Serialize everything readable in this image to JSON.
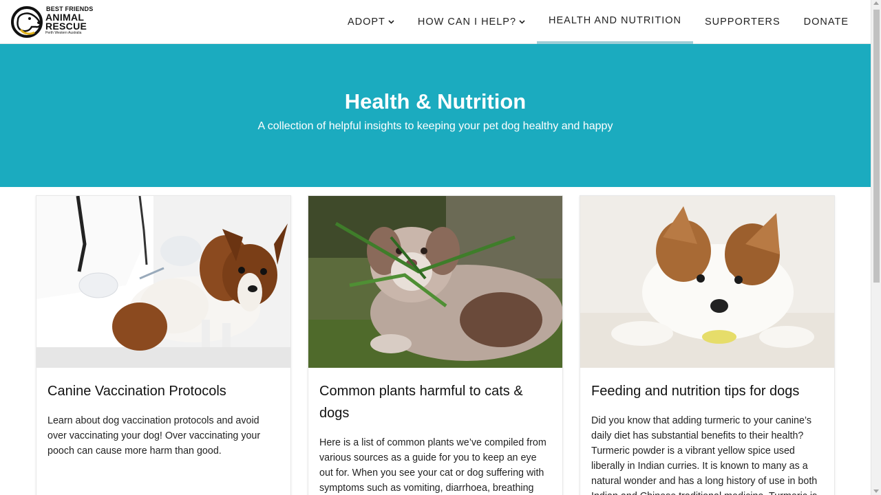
{
  "logo": {
    "line1": "BEST FRIENDS",
    "line2": "ANIMAL",
    "line3": "RESCUE",
    "line4": "Perth Western Australia"
  },
  "nav": {
    "items": [
      {
        "label": "ADOPT",
        "dropdown": true
      },
      {
        "label": "HOW CAN I HELP?",
        "dropdown": true
      },
      {
        "label": "HEALTH AND NUTRITION",
        "dropdown": false,
        "active": true
      },
      {
        "label": "SUPPORTERS",
        "dropdown": false
      },
      {
        "label": "DONATE",
        "dropdown": false
      }
    ]
  },
  "hero": {
    "title": "Health & Nutrition",
    "subtitle": "A collection of helpful insights to keeping your pet dog healthy and happy",
    "background": "#1babbf"
  },
  "cards": [
    {
      "image": "dog-vaccination-photo",
      "title": "Canine Vaccination Protocols",
      "text": "Learn about dog vaccination protocols and avoid over vaccinating your dog! Over vaccinating your pooch can cause more harm than good."
    },
    {
      "image": "puppy-chewing-plant-photo",
      "title": "Common plants harmful to cats & dogs",
      "text": "Here is a list of common plants we’ve compiled from various sources as a guide for you to keep an eye out for. When you see your cat or dog suffering with symptoms such as vomiting, diarrhoea, breathing"
    },
    {
      "image": "jack-russell-lying-photo",
      "title": "Feeding and nutrition tips for dogs",
      "text": "Did you know that adding turmeric to your canine’s daily diet has substantial benefits to their health? Turmeric powder is a vibrant yellow spice used liberally in Indian curries. It is known to many as a natural wonder and has a long history of use in both Indian and Chinese traditional medicine. Turmeric is"
    }
  ]
}
